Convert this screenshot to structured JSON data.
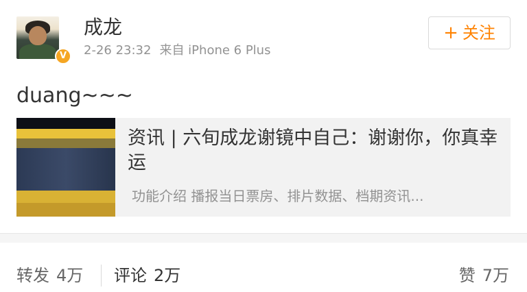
{
  "post": {
    "author": {
      "name": "成龙",
      "avatar_icon": "avatar-photo",
      "verified_icon": "verified-badge-icon",
      "verified_mark": "V",
      "verified_color": "#f5a623"
    },
    "time": "2-26 23:32",
    "source": "来自 iPhone 6 Plus",
    "follow_button": {
      "icon": "+",
      "label": "关注",
      "color": "#ff8200"
    },
    "text": "duang~~~",
    "card": {
      "title": "资讯 | 六旬成龙谢镜中自己：谢谢你，你真幸运",
      "description": "功能介绍 播报当日票房、排片数据、档期资讯..."
    }
  },
  "actions": {
    "repost": {
      "label": "转发",
      "count": "4万"
    },
    "comment": {
      "label": "评论",
      "count": "2万"
    },
    "like": {
      "label": "赞",
      "count": "7万"
    }
  }
}
